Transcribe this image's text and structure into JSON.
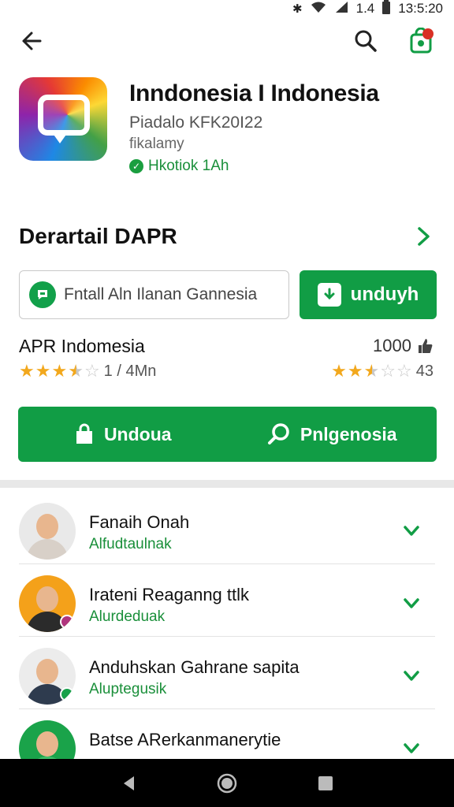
{
  "status_bar": {
    "signal": "1.4",
    "time": "13:5:20",
    "icons": [
      "bluetooth-icon",
      "wifi-icon",
      "cell-signal-icon",
      "battery-icon"
    ]
  },
  "app_bar": {
    "icons": [
      "back-arrow-icon",
      "search-icon",
      "store-bag-icon"
    ]
  },
  "app": {
    "title": "Inndonesia I Indonesia",
    "developer": "Piadalo KFK20I22",
    "category": "fikalamy",
    "verified_label": "Hkotiok 1Ah",
    "icon_colors": [
      "#1e88e5",
      "#8e24aa",
      "#e53935",
      "#fb8c00",
      "#fdd835",
      "#43a047"
    ]
  },
  "section": {
    "title": "Derartail DAPR"
  },
  "search": {
    "placeholder": "Fntall Aln Ilanan Gannesia"
  },
  "download_button": {
    "label": "unduyh"
  },
  "rating": {
    "app_name": "APR Indomesia",
    "count": "1000",
    "left_stars": 3.5,
    "left_text": "1 / 4Mn",
    "right_stars": 2.5,
    "right_text": "43"
  },
  "actions": [
    {
      "label": "Undoua",
      "icon": "download-bag-icon"
    },
    {
      "label": "Pnlgenosia",
      "icon": "search-icon"
    }
  ],
  "list_items": [
    {
      "name": "Fanaih Onah",
      "sub": "Alfudtaulnak",
      "avatar_bg": "#e9e9e9",
      "body_color": "#d8d0c8"
    },
    {
      "name": "Irateni Reaganng ttlk",
      "sub": "Alurdeduak",
      "avatar_bg": "#f4a11a",
      "body_color": "#2b2b2b",
      "badge_color": "#b0357e"
    },
    {
      "name": "Anduhskan Gahrane sapita",
      "sub": "Aluptegusik",
      "avatar_bg": "#ececec",
      "body_color": "#2e3b4e",
      "badge_color": "#18a04a"
    },
    {
      "name": "Batse ARerkanmanerytie",
      "sub": "",
      "avatar_bg": "#1aa34a",
      "body_color": "#3fbf6a"
    }
  ],
  "colors": {
    "accent": "#119d45",
    "accent_text": "#1a8f3a",
    "star": "#f2a81d"
  }
}
